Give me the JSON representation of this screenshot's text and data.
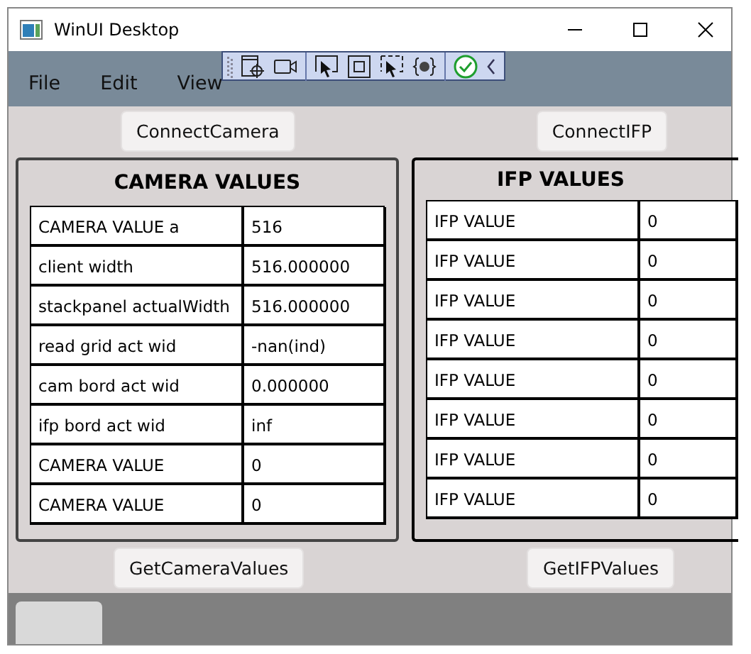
{
  "window": {
    "title": "WinUI Desktop"
  },
  "menu": [
    "File",
    "Edit",
    "View"
  ],
  "top_buttons": [
    "ConnectCamera",
    "ConnectIFP"
  ],
  "camera_panel": {
    "title": "CAMERA VALUES",
    "rows": [
      {
        "name": "CAMERA VALUE a",
        "value": "516"
      },
      {
        "name": "client width",
        "value": "516.000000"
      },
      {
        "name": "stackpanel actualWidth",
        "value": "516.000000"
      },
      {
        "name": "read grid act wid",
        "value": "-nan(ind)"
      },
      {
        "name": "cam bord act wid",
        "value": "0.000000"
      },
      {
        "name": "ifp bord act wid",
        "value": "inf"
      },
      {
        "name": "CAMERA VALUE",
        "value": "0"
      },
      {
        "name": "CAMERA VALUE",
        "value": "0"
      }
    ]
  },
  "ifp_panel": {
    "title": "IFP VALUES",
    "rows": [
      {
        "name": "IFP VALUE",
        "value": "0"
      },
      {
        "name": "IFP VALUE",
        "value": "0"
      },
      {
        "name": "IFP VALUE",
        "value": "0"
      },
      {
        "name": "IFP VALUE",
        "value": "0"
      },
      {
        "name": "IFP VALUE",
        "value": "0"
      },
      {
        "name": "IFP VALUE",
        "value": "0"
      },
      {
        "name": "IFP VALUE",
        "value": "0"
      },
      {
        "name": "IFP VALUE",
        "value": "0"
      }
    ]
  },
  "bottom_buttons": [
    "GetCameraValues",
    "GetIFPValues"
  ]
}
